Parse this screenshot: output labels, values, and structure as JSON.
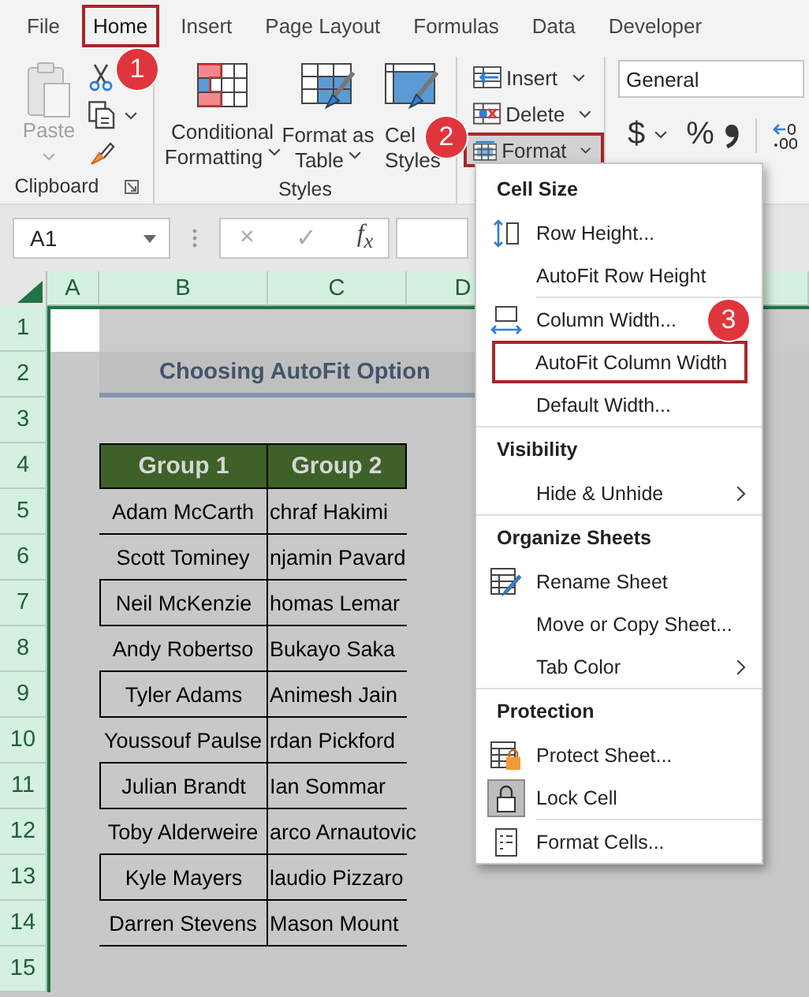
{
  "menu_bar": {
    "tabs": [
      {
        "label": "File",
        "selected": false,
        "annotated": false
      },
      {
        "label": "Home",
        "selected": true,
        "annotated": true
      },
      {
        "label": "Insert",
        "selected": false,
        "annotated": false
      },
      {
        "label": "Page Layout",
        "selected": false,
        "annotated": false
      },
      {
        "label": "Formulas",
        "selected": false,
        "annotated": false
      },
      {
        "label": "Data",
        "selected": false,
        "annotated": false
      },
      {
        "label": "Developer",
        "selected": false,
        "annotated": false
      }
    ]
  },
  "ribbon": {
    "clipboard": {
      "label": "Clipboard",
      "paste": {
        "label": "Paste",
        "disabled": true
      }
    },
    "styles": {
      "label": "Styles",
      "buttons": [
        {
          "lines": [
            "Conditional",
            "Formatting"
          ]
        },
        {
          "lines": [
            "Format as",
            "Table"
          ]
        },
        {
          "lines": [
            "Cel",
            "Styles"
          ]
        }
      ]
    },
    "cells": {
      "buttons": [
        {
          "label": "Insert",
          "annotated": false,
          "expanded": false
        },
        {
          "label": "Delete",
          "annotated": false,
          "expanded": false
        },
        {
          "label": "Format",
          "annotated": true,
          "expanded": true
        }
      ]
    },
    "number": {
      "format": "General",
      "currency": "$",
      "percent": "%"
    }
  },
  "formula_bar": {
    "name_box": "A1",
    "cancel": "×",
    "enter": "✓",
    "function": "f$_{x}$"
  },
  "sheet": {
    "columns": [
      "A",
      "B",
      "C",
      "D"
    ],
    "rows": [
      "1",
      "2",
      "3",
      "4",
      "5",
      "6",
      "7",
      "8",
      "9",
      "10",
      "11",
      "12",
      "13",
      "14",
      "15"
    ],
    "title": "Choosing AutoFit Option",
    "table": {
      "columns": [
        "Group 1",
        "Group 2"
      ],
      "rows": [
        [
          "Adam McCarth",
          "chraf Hakimi"
        ],
        [
          "Scott Tominey",
          "njamin Pavard"
        ],
        [
          "Neil McKenzie",
          "homas Lemar"
        ],
        [
          "Andy Robertso",
          "Bukayo Saka"
        ],
        [
          "Tyler Adams",
          "Animesh Jain"
        ],
        [
          "Youssouf Paulse",
          "rdan Pickford"
        ],
        [
          "Julian Brandt",
          "Ian Sommar"
        ],
        [
          "Toby Alderweire",
          "arco Arnautovic"
        ],
        [
          "Kyle Mayers",
          "laudio Pizzaro"
        ],
        [
          "Darren Stevens",
          "Mason Mount"
        ]
      ]
    }
  },
  "format_menu": {
    "sections": [
      {
        "title": "Cell Size",
        "items": [
          {
            "label": "Row Height...",
            "submenu": false,
            "checked": false,
            "annotated": false,
            "divider_above": false
          },
          {
            "label": "AutoFit Row Height",
            "submenu": false,
            "checked": false,
            "annotated": false,
            "divider_above": false
          },
          {
            "label": "Column Width...",
            "submenu": false,
            "checked": false,
            "annotated": false,
            "divider_above": true
          },
          {
            "label": "AutoFit Column Width",
            "submenu": false,
            "checked": false,
            "annotated": true,
            "divider_above": false
          },
          {
            "label": "Default Width...",
            "submenu": false,
            "checked": false,
            "annotated": false,
            "divider_above": false
          }
        ]
      },
      {
        "title": "Visibility",
        "items": [
          {
            "label": "Hide & Unhide",
            "submenu": true,
            "checked": false,
            "annotated": false,
            "divider_above": false
          }
        ]
      },
      {
        "title": "Organize Sheets",
        "items": [
          {
            "label": "Rename Sheet",
            "submenu": false,
            "checked": false,
            "annotated": false,
            "divider_above": false
          },
          {
            "label": "Move or Copy Sheet...",
            "submenu": false,
            "checked": false,
            "annotated": false,
            "divider_above": false
          },
          {
            "label": "Tab Color",
            "submenu": true,
            "checked": false,
            "annotated": false,
            "divider_above": false
          }
        ]
      },
      {
        "title": "Protection",
        "items": [
          {
            "label": "Protect Sheet...",
            "submenu": false,
            "checked": false,
            "annotated": false,
            "divider_above": false
          },
          {
            "label": "Lock Cell",
            "submenu": false,
            "checked": true,
            "annotated": false,
            "divider_above": false
          },
          {
            "label": "Format Cells...",
            "submenu": false,
            "checked": false,
            "annotated": false,
            "divider_above": true
          }
        ]
      }
    ]
  },
  "callouts": [
    "1",
    "2",
    "3"
  ]
}
